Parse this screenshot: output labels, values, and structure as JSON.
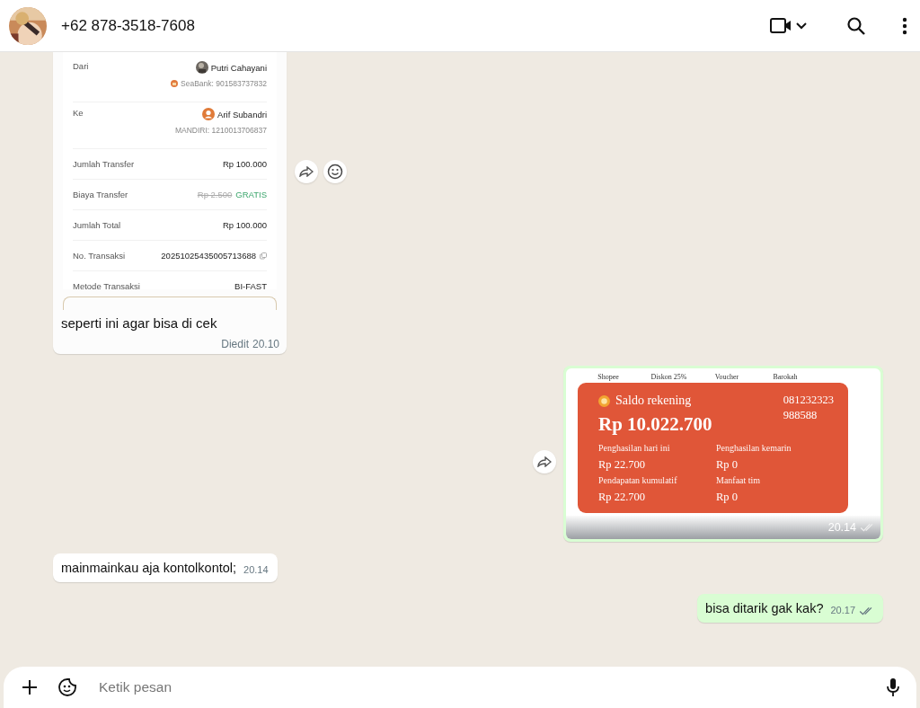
{
  "header": {
    "title": "+62 878-3518-7608"
  },
  "messages": [
    {
      "kind": "receipt",
      "outgoing": false,
      "forward": true,
      "react": true,
      "receipt": {
        "rows": [
          {
            "kind": "party",
            "label": "Dari",
            "name": "Putri Cahayani",
            "account": "SeaBank: 901583737832"
          },
          {
            "kind": "party",
            "label": "Ke",
            "name": "Arif Subandri",
            "account": "MANDIRI: 1210013706837"
          },
          {
            "kind": "value",
            "label": "Jumlah Transfer",
            "value": "Rp 100.000"
          },
          {
            "kind": "fee",
            "label": "Biaya Transfer",
            "old": "Rp 2.500",
            "value": "GRATIS"
          },
          {
            "kind": "value",
            "label": "Jumlah Total",
            "value": "Rp 100.000"
          },
          {
            "kind": "copy",
            "label": "No. Transaksi",
            "value": "20251025435005713688"
          },
          {
            "kind": "value",
            "label": "Metode Transaksi",
            "value": "BI-FAST"
          }
        ]
      },
      "text": "seperti ini agar bisa di cek",
      "edited": "Diedit",
      "time": "20.10"
    },
    {
      "outgoing": true,
      "forward": true,
      "react": false,
      "shot": {
        "menu": [
          "Shopee",
          "Diskon 25%",
          "Voucher",
          "Barokah"
        ],
        "balance_label": "Saldo rekening",
        "account_lines": [
          "081232323",
          "988588"
        ],
        "balance": "Rp 10.022.700",
        "stats": [
          {
            "label": "Penghasilan hari ini",
            "value": "Rp 22.700"
          },
          {
            "label": "Penghasilan kemarin",
            "value": "Rp 0"
          },
          {
            "label": "Pendapatan kumulatif",
            "value": "Rp 22.700"
          },
          {
            "label": "Manfaat tim",
            "value": "Rp 0"
          }
        ]
      },
      "time": "20.14"
    },
    {
      "kind": "text",
      "outgoing": false,
      "forward": false,
      "react": false,
      "text": "mainmainkau aja kontolkontol;",
      "time": "20.14"
    },
    {
      "kind": "text",
      "outgoing": true,
      "forward": false,
      "react": false,
      "text": "bisa ditarik gak kak?",
      "time": "20.17"
    }
  ],
  "composer": {
    "placeholder": "Ketik pesan"
  }
}
